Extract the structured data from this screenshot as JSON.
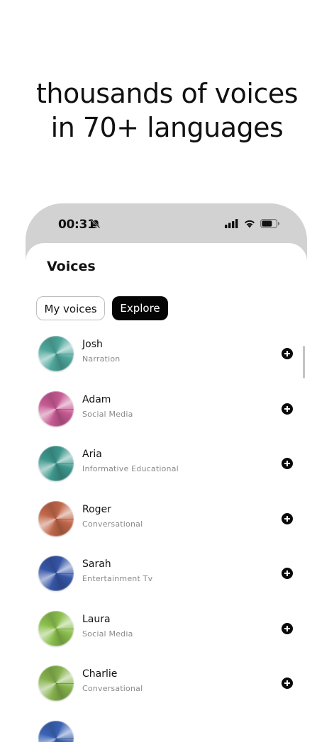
{
  "headline": {
    "line1": "thousands of voices",
    "line2": "in 70+ languages"
  },
  "status_bar": {
    "time": "00:31",
    "icons": [
      "bell-slash-icon",
      "cellular-signal-icon",
      "wifi-icon",
      "battery-icon"
    ]
  },
  "screen": {
    "title": "Voices",
    "tabs": [
      {
        "label": "My voices",
        "active": false
      },
      {
        "label": "Explore",
        "active": true
      }
    ]
  },
  "voices": [
    {
      "name": "Josh",
      "category": "Narration",
      "color": "#4fa79c"
    },
    {
      "name": "Adam",
      "category": "Social Media",
      "color": "#c65a93"
    },
    {
      "name": "Aria",
      "category": "Informative Educational",
      "color": "#3e978d"
    },
    {
      "name": "Roger",
      "category": "Conversational",
      "color": "#c0674a"
    },
    {
      "name": "Sarah",
      "category": "Entertainment Tv",
      "color": "#3656a6"
    },
    {
      "name": "Laura",
      "category": "Social Media",
      "color": "#8cbf4e"
    },
    {
      "name": "Charlie",
      "category": "Conversational",
      "color": "#86b24e"
    },
    {
      "name": "",
      "category": "",
      "color": "#3b63b4"
    }
  ],
  "add_icon": "plus-circle-icon"
}
